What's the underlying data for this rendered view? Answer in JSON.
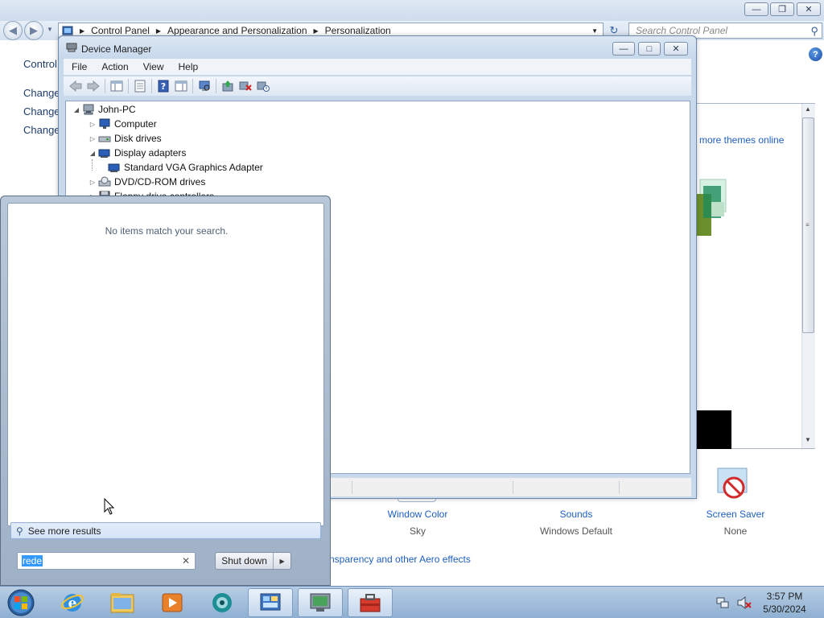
{
  "control_panel": {
    "breadcrumb": [
      "Control Panel",
      "Appearance and Personalization",
      "Personalization"
    ],
    "search_placeholder": "Search Control Panel",
    "sidebar": [
      "Control",
      "Change",
      "Change",
      "Change"
    ],
    "themes_link": "more themes online",
    "items": [
      {
        "title": "Window Color",
        "value": "Sky"
      },
      {
        "title": "Sounds",
        "value": "Windows Default"
      },
      {
        "title": "Screen Saver",
        "value": "None"
      }
    ],
    "aero_link": "nsparency and other Aero effects"
  },
  "device_manager": {
    "title": "Device Manager",
    "menus": [
      "File",
      "Action",
      "View",
      "Help"
    ],
    "toolbar_icons": [
      "back-icon",
      "forward-icon",
      "show-hide-console-tree-icon",
      "properties-icon",
      "help-icon",
      "show-hide-action-pane-icon",
      "scan-hardware-icon",
      "update-driver-icon",
      "uninstall-device-icon",
      "disable-device-icon"
    ],
    "tree": [
      {
        "label": "John-PC",
        "expanded": true,
        "icon": "computer-icon"
      },
      {
        "label": "Computer",
        "expanded": false,
        "icon": "monitor-icon"
      },
      {
        "label": "Disk drives",
        "expanded": false,
        "icon": "disk-drive-icon"
      },
      {
        "label": "Display adapters",
        "expanded": true,
        "icon": "display-adapter-icon"
      },
      {
        "label": "Standard VGA Graphics Adapter",
        "icon": "display-adapter-icon"
      },
      {
        "label": "DVD/CD-ROM drives",
        "expanded": false,
        "icon": "cd-drive-icon"
      },
      {
        "label": "Floppy drive controllers",
        "expanded": false,
        "icon": "floppy-icon"
      }
    ]
  },
  "start_menu": {
    "no_items": "No items match your search.",
    "see_more": "See more results",
    "search_value": "rede",
    "shutdown_label": "Shut down"
  },
  "taskbar": {
    "apps": [
      "windows-explorer-icon",
      "internet-explorer-icon",
      "media-player-icon",
      "browser-icon",
      "control-panel-icon",
      "device-manager-icon",
      "toolbox-icon"
    ],
    "time": "3:57 PM",
    "date": "5/30/2024"
  },
  "colors": {
    "link": "#1f5fbf",
    "selection": "#3399ff",
    "taskbar": "#9fbcda"
  }
}
